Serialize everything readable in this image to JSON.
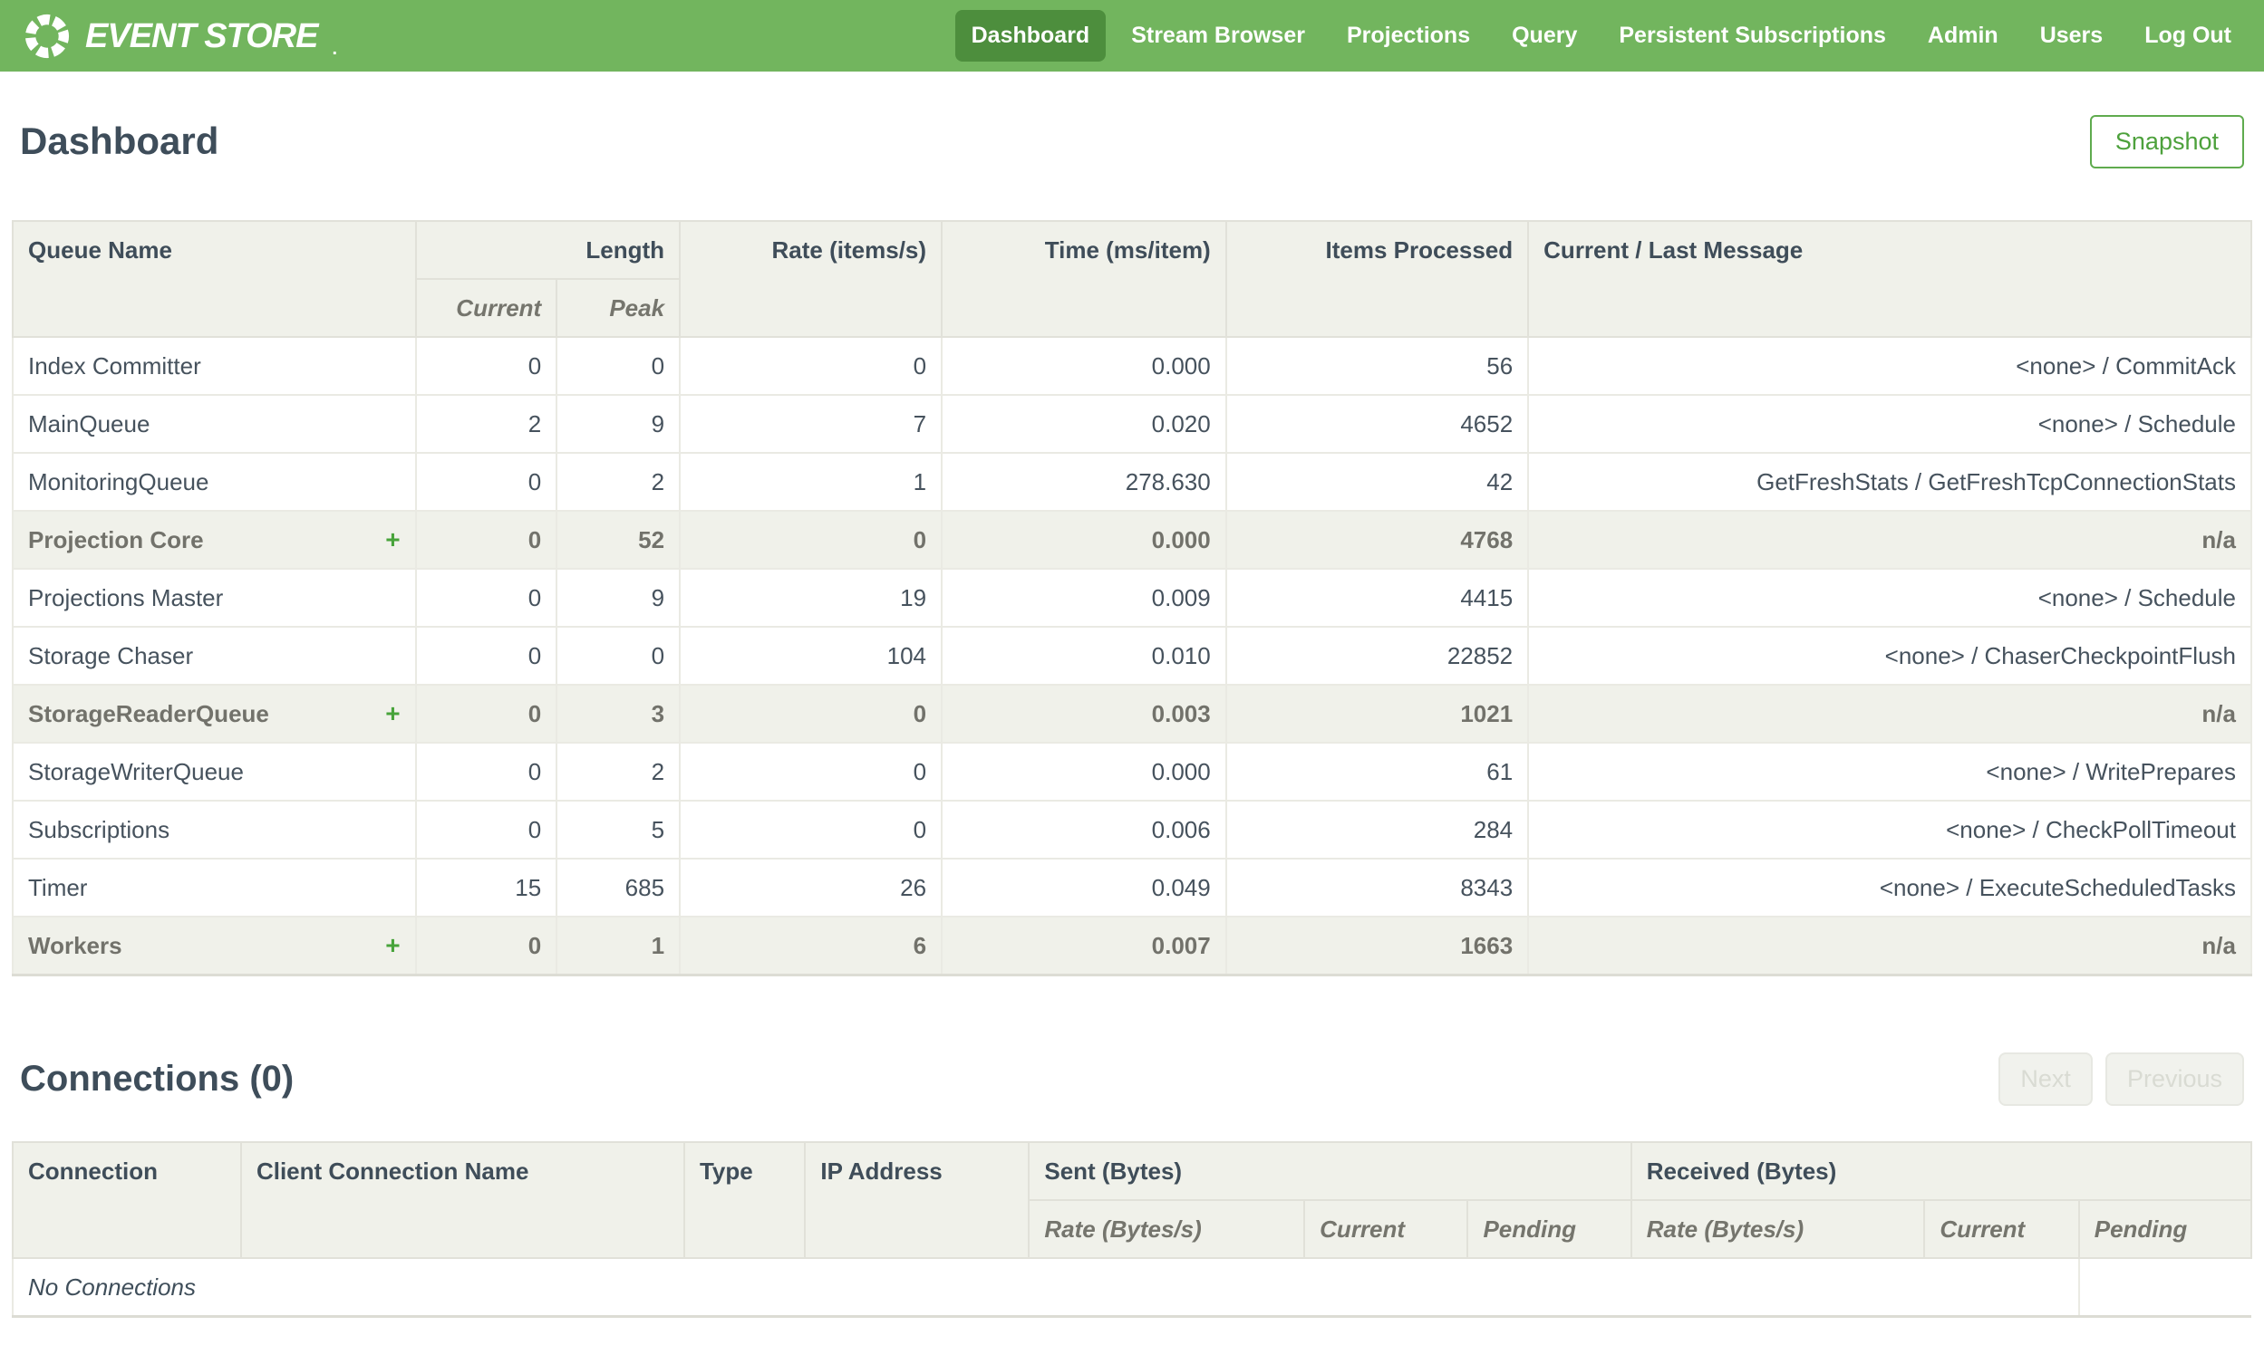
{
  "brand": {
    "name": "EVENT STORE",
    "mark": "."
  },
  "nav": {
    "items": [
      {
        "label": "Dashboard",
        "active": true
      },
      {
        "label": "Stream Browser",
        "active": false
      },
      {
        "label": "Projections",
        "active": false
      },
      {
        "label": "Query",
        "active": false
      },
      {
        "label": "Persistent Subscriptions",
        "active": false
      },
      {
        "label": "Admin",
        "active": false
      },
      {
        "label": "Users",
        "active": false
      },
      {
        "label": "Log Out",
        "active": false
      }
    ]
  },
  "page": {
    "title": "Dashboard",
    "snapshot_label": "Snapshot"
  },
  "queues_table": {
    "headers": {
      "queue_name": "Queue Name",
      "length": "Length",
      "current": "Current",
      "peak": "Peak",
      "rate": "Rate (items/s)",
      "time": "Time (ms/item)",
      "items_processed": "Items Processed",
      "message": "Current / Last Message"
    },
    "expander_symbol": "+",
    "rows": [
      {
        "name": "Index Committer",
        "group": false,
        "current": "0",
        "peak": "0",
        "rate": "0",
        "time": "0.000",
        "items": "56",
        "message": "<none> / CommitAck"
      },
      {
        "name": "MainQueue",
        "group": false,
        "current": "2",
        "peak": "9",
        "rate": "7",
        "time": "0.020",
        "items": "4652",
        "message": "<none> / Schedule"
      },
      {
        "name": "MonitoringQueue",
        "group": false,
        "current": "0",
        "peak": "2",
        "rate": "1",
        "time": "278.630",
        "items": "42",
        "message": "GetFreshStats / GetFreshTcpConnectionStats"
      },
      {
        "name": "Projection Core",
        "group": true,
        "current": "0",
        "peak": "52",
        "rate": "0",
        "time": "0.000",
        "items": "4768",
        "message": "n/a"
      },
      {
        "name": "Projections Master",
        "group": false,
        "current": "0",
        "peak": "9",
        "rate": "19",
        "time": "0.009",
        "items": "4415",
        "message": "<none> / Schedule"
      },
      {
        "name": "Storage Chaser",
        "group": false,
        "current": "0",
        "peak": "0",
        "rate": "104",
        "time": "0.010",
        "items": "22852",
        "message": "<none> / ChaserCheckpointFlush"
      },
      {
        "name": "StorageReaderQueue",
        "group": true,
        "current": "0",
        "peak": "3",
        "rate": "0",
        "time": "0.003",
        "items": "1021",
        "message": "n/a"
      },
      {
        "name": "StorageWriterQueue",
        "group": false,
        "current": "0",
        "peak": "2",
        "rate": "0",
        "time": "0.000",
        "items": "61",
        "message": "<none> / WritePrepares"
      },
      {
        "name": "Subscriptions",
        "group": false,
        "current": "0",
        "peak": "5",
        "rate": "0",
        "time": "0.006",
        "items": "284",
        "message": "<none> / CheckPollTimeout"
      },
      {
        "name": "Timer",
        "group": false,
        "current": "15",
        "peak": "685",
        "rate": "26",
        "time": "0.049",
        "items": "8343",
        "message": "<none> / ExecuteScheduledTasks"
      },
      {
        "name": "Workers",
        "group": true,
        "current": "0",
        "peak": "1",
        "rate": "6",
        "time": "0.007",
        "items": "1663",
        "message": "n/a"
      }
    ]
  },
  "connections": {
    "title": "Connections (0)",
    "next_label": "Next",
    "previous_label": "Previous",
    "table": {
      "headers": {
        "connection": "Connection",
        "client_name": "Client Connection Name",
        "type": "Type",
        "ip": "IP Address",
        "sent": "Sent (Bytes)",
        "received": "Received (Bytes)"
      },
      "sub_headers": [
        "Rate (Bytes/s)",
        "Current",
        "Pending"
      ],
      "empty_text": "No Connections"
    }
  },
  "colors": {
    "navbar_green": "#72b55e",
    "active_nav_green": "#4d8e3d",
    "accent_green": "#4da13c",
    "header_bg": "#f0f1ea",
    "text_slate": "#3e4d5a"
  }
}
